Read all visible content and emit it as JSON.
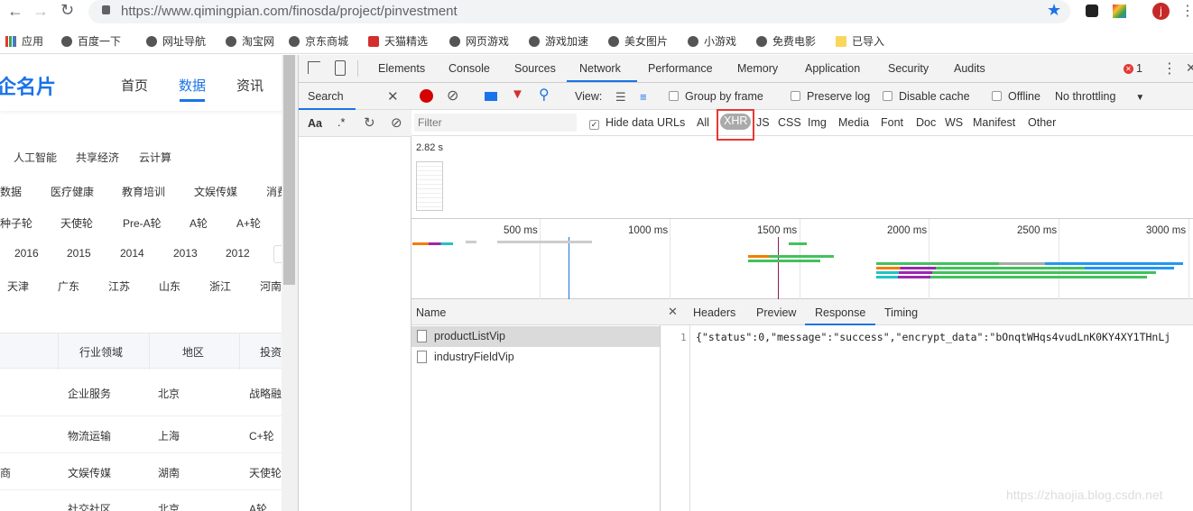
{
  "browser": {
    "url_host": "https://www.qimingpian.com",
    "url_path": "/finosda/project/pinvestment",
    "avatar": "j",
    "bookmarks": [
      "应用",
      "百度一下",
      "网址导航",
      "淘宝网",
      "京东商城",
      "天猫精选",
      "网页游戏",
      "游戏加速",
      "美女图片",
      "小游戏",
      "免费电影",
      "已导入"
    ]
  },
  "site": {
    "logo": "企名片",
    "nav": [
      "首页",
      "数据",
      "资讯"
    ],
    "active_nav": "数据",
    "tags": [
      "人工智能",
      "共享经济",
      "云计算"
    ],
    "industries": [
      "数据",
      "医疗健康",
      "教育培训",
      "文娱传媒",
      "消费"
    ],
    "rounds": [
      "种子轮",
      "天使轮",
      "Pre-A轮",
      "A轮",
      "A+轮"
    ],
    "years": [
      "2016",
      "2015",
      "2014",
      "2013",
      "2012"
    ],
    "regions": [
      "天津",
      "广东",
      "江苏",
      "山东",
      "浙江",
      "河南"
    ],
    "table_headers": [
      "行业领域",
      "地区",
      "投资"
    ],
    "rows": [
      [
        "",
        "企业服务",
        "北京",
        "战略融"
      ],
      [
        "",
        "物流运输",
        "上海",
        "C+轮"
      ],
      [
        "商",
        "文娱传媒",
        "湖南",
        "天使轮"
      ],
      [
        "",
        "社交社区",
        "北京",
        "A轮"
      ]
    ]
  },
  "devtools": {
    "tabs": [
      "Elements",
      "Console",
      "Sources",
      "Network",
      "Performance",
      "Memory",
      "Application",
      "Security",
      "Audits"
    ],
    "active_tab": "Network",
    "error_count": "1",
    "search_label": "Search",
    "aa": "Aa",
    "regex": ".*",
    "view_label": "View:",
    "group_by_frame": "Group by frame",
    "preserve_log": "Preserve log",
    "disable_cache": "Disable cache",
    "offline": "Offline",
    "throttling": "No throttling",
    "filter_placeholder": "Filter",
    "hide_data_urls": "Hide data URLs",
    "filters": [
      "All",
      "XHR",
      "JS",
      "CSS",
      "Img",
      "Media",
      "Font",
      "Doc",
      "WS",
      "Manifest",
      "Other"
    ],
    "active_filter": "XHR",
    "filmstrip_time": "2.82 s",
    "timeline_ticks": [
      "500 ms",
      "1000 ms",
      "1500 ms",
      "2000 ms",
      "2500 ms",
      "3000 ms"
    ],
    "name_header": "Name",
    "requests": [
      "productListVip",
      "industryFieldVip"
    ],
    "detail_tabs": [
      "Headers",
      "Preview",
      "Response",
      "Timing"
    ],
    "active_detail": "Response",
    "response_line_no": "1",
    "response_text": "{\"status\":0,\"message\":\"success\",\"encrypt_data\":\"bOnqtWHqs4vudLnK0KY4XY1THnLj"
  },
  "watermark": "https://zhaojia.blog.csdn.net",
  "colors": {
    "accent": "#1a73e8",
    "highlight_box": "#e53935"
  }
}
